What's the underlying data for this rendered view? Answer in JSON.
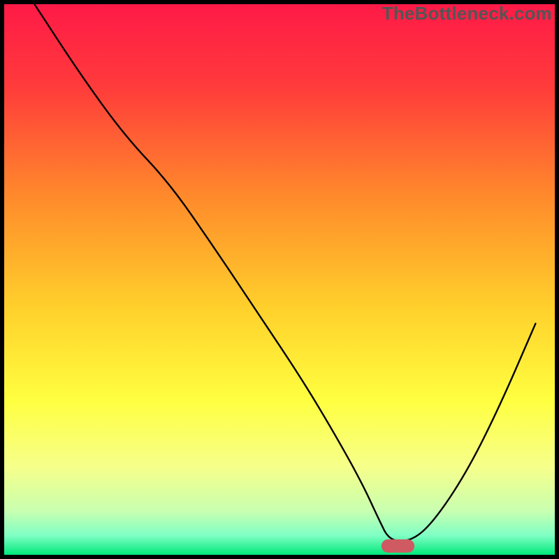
{
  "watermark": "TheBottleneck.com",
  "chart_data": {
    "type": "line",
    "title": "",
    "xlabel": "",
    "ylabel": "",
    "xlim": [
      0,
      100
    ],
    "ylim": [
      0,
      100
    ],
    "legend": false,
    "grid": false,
    "background_gradient": {
      "stops": [
        {
          "offset": 0.0,
          "color": "#ff1a47"
        },
        {
          "offset": 0.15,
          "color": "#ff3b3b"
        },
        {
          "offset": 0.35,
          "color": "#ff8a2b"
        },
        {
          "offset": 0.55,
          "color": "#ffd02b"
        },
        {
          "offset": 0.72,
          "color": "#ffff40"
        },
        {
          "offset": 0.84,
          "color": "#f6ff8a"
        },
        {
          "offset": 0.92,
          "color": "#c9ffb0"
        },
        {
          "offset": 0.965,
          "color": "#7fffc4"
        },
        {
          "offset": 1.0,
          "color": "#00e87a"
        }
      ]
    },
    "series": [
      {
        "name": "bottleneck-curve",
        "color": "#000000",
        "width": 2.4,
        "x": [
          5.5,
          14,
          22,
          30,
          38,
          46,
          54,
          60,
          65,
          68,
          70,
          74,
          78,
          84,
          90,
          96.5
        ],
        "y": [
          100,
          87,
          76,
          67.5,
          56,
          44,
          32,
          22,
          13,
          6.5,
          2.5,
          2.5,
          6,
          15,
          27,
          42
        ]
      }
    ],
    "marker": {
      "name": "optimal-range-marker",
      "color": "#cf5a62",
      "x_start": 68.5,
      "x_end": 74.5,
      "y": 1.6,
      "height": 2.4
    },
    "frame": {
      "color": "#000000",
      "width": 6
    }
  }
}
